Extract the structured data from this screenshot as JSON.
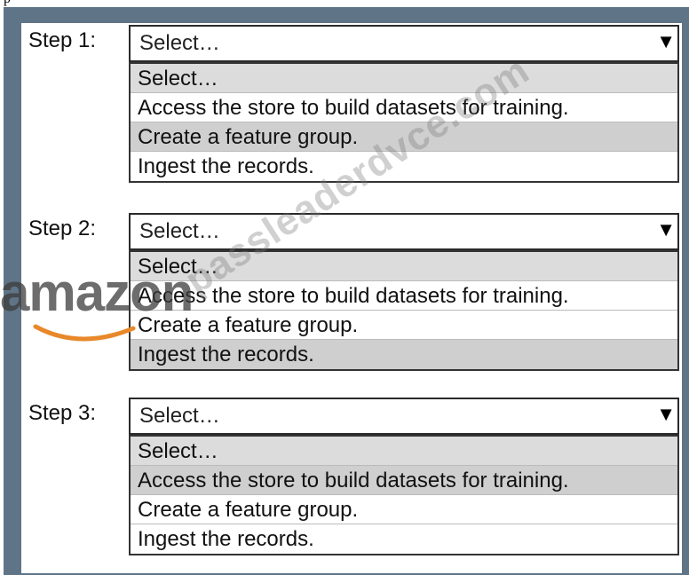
{
  "header": {
    "top_text": "p"
  },
  "steps": [
    {
      "label": "Step 1:",
      "selected": "Select…",
      "options": [
        "Select…",
        "Access the store to build datasets for training.",
        "Create a feature group.",
        "Ingest the records."
      ]
    },
    {
      "label": "Step 2:",
      "selected": "Select…",
      "options": [
        "Select…",
        "Access the store to build datasets for training.",
        "Create a feature group.",
        "Ingest the records."
      ]
    },
    {
      "label": "Step 3:",
      "selected": "Select…",
      "options": [
        "Select…",
        "Access the store to build datasets for training.",
        "Create a feature group.",
        "Ingest the records."
      ]
    }
  ],
  "dropdown_arrow": "▼",
  "watermark": {
    "text": "passleaderdvce.com",
    "logo": "amazon"
  },
  "colors": {
    "frame": "#5f7587",
    "option_shade": "#dcdcdc",
    "logo_swoosh": "#e8882a"
  }
}
